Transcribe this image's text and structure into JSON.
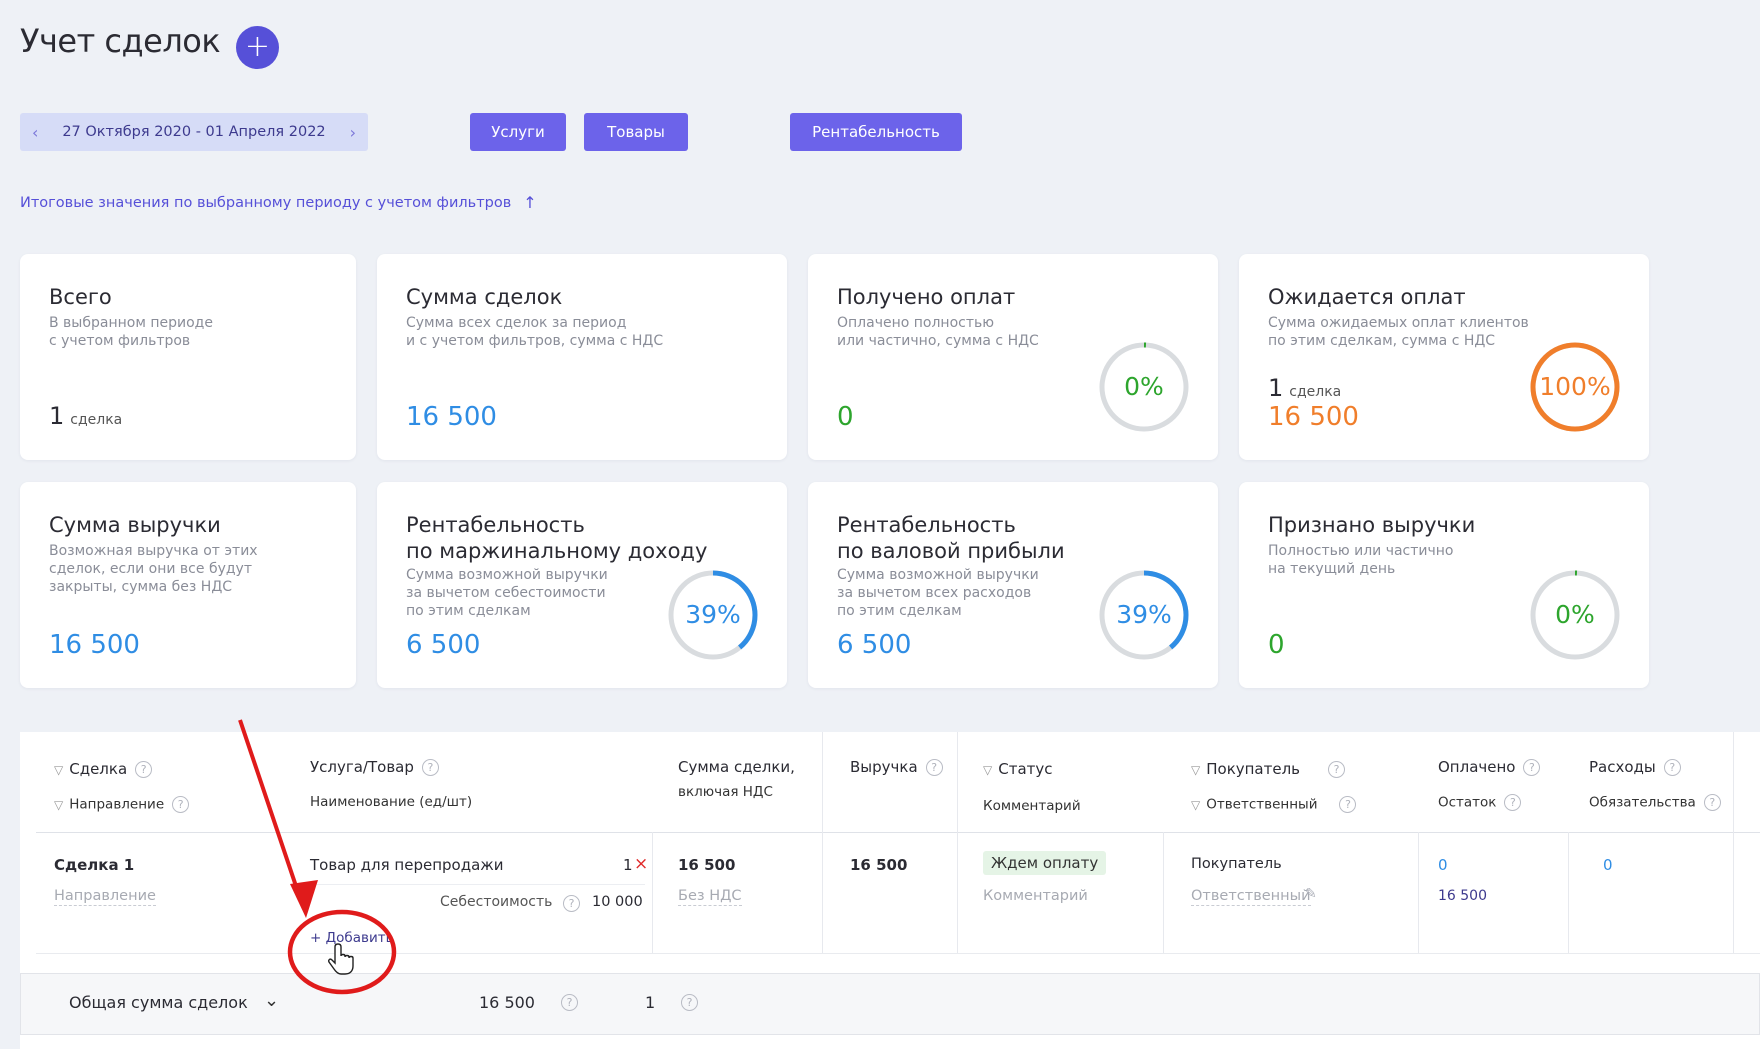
{
  "header": {
    "title": "Учет сделок",
    "add_icon": "+"
  },
  "toolbar": {
    "date_range": "27 Октября 2020 - 01 Апреля 2022",
    "prev_icon": "‹",
    "next_icon": "›",
    "services_label": "Услуги",
    "goods_label": "Товары",
    "profitability_label": "Рентабельность"
  },
  "summary_link": {
    "text": "Итоговые значения по выбранному периоду с учетом фильтров",
    "icon": "↑"
  },
  "cards": {
    "total": {
      "title": "Всего",
      "sub": "В выбранном периоде\nс учетом фильтров",
      "count": "1",
      "unit": "сделка"
    },
    "deal_sum": {
      "title": "Сумма сделок",
      "sub": "Сумма всех сделок за период\nи с учетом фильтров, сумма с НДС",
      "value": "16 500"
    },
    "received": {
      "title": "Получено оплат",
      "sub": "Оплачено полностью\nили частично, сумма с НДС",
      "value": "0",
      "pct": "0%",
      "pct_value": 0
    },
    "expected": {
      "title": "Ожидается оплат",
      "sub": "Сумма ожидаемых оплат клиентов\nпо этим сделкам, сумма с НДС",
      "count": "1",
      "unit": "сделка",
      "value": "16 500",
      "pct": "100%",
      "pct_value": 100
    },
    "revenue": {
      "title": "Сумма выручки",
      "sub": "Возможная выручка от этих\nсделок, если они все будут\nзакрыты, сумма без НДС",
      "value": "16 500"
    },
    "margin": {
      "title": "Рентабельность\nпо маржинальному доходу",
      "sub": "Сумма возможной выручки\nза вычетом себестоимости\nпо этим сделкам",
      "value": "6 500",
      "pct": "39%",
      "pct_value": 39
    },
    "gross": {
      "title": "Рентабельность\nпо валовой прибыли",
      "sub": "Сумма возможной выручки\nза вычетом всех расходов\nпо этим сделкам",
      "value": "6 500",
      "pct": "39%",
      "pct_value": 39
    },
    "recognized": {
      "title": "Признано выручки",
      "sub": "Полностью или частично\nна текущий день",
      "value": "0",
      "pct": "0%",
      "pct_value": 0
    }
  },
  "table": {
    "headers": {
      "deal": "Сделка",
      "direction": "Направление",
      "product": "Услуга/Товар",
      "product_sub": "Наименование (ед/шт)",
      "amount": "Сумма сделки,",
      "amount_sub": "включая НДС",
      "revenue": "Выручка",
      "status": "Статус",
      "comment": "Комментарий",
      "buyer": "Покупатель",
      "responsible": "Ответственный",
      "paid": "Оплачено",
      "remaining": "Остаток",
      "expenses": "Расходы",
      "obligations": "Обязательства",
      "help_icon": "?",
      "filter_icon": "▽"
    },
    "row": {
      "deal": "Сделка 1",
      "direction_placeholder": "Направление",
      "product_name": "Товар для перепродажи",
      "quantity": "1",
      "remove_icon": "×",
      "cost_label": "Себестоимость",
      "cost_value": "10 000",
      "add_label": "+ Добавить",
      "amount": "16 500",
      "vat_label": "Без НДС",
      "revenue": "16 500",
      "status": "Ждем оплату",
      "comment_placeholder": "Комментарий",
      "buyer": "Покупатель",
      "responsible_placeholder": "Ответственный",
      "edit_icon": "✎",
      "paid": "0",
      "remaining": "16 500",
      "expenses": "0"
    }
  },
  "footer": {
    "label": "Общая сумма сделок",
    "chevron": "⌄",
    "total": "16 500",
    "count": "1"
  },
  "colors": {
    "accent": "#5650d8",
    "blue": "#2f8de4",
    "green": "#2da52d",
    "orange": "#f07e2b",
    "annotation": "#e01b1b"
  }
}
